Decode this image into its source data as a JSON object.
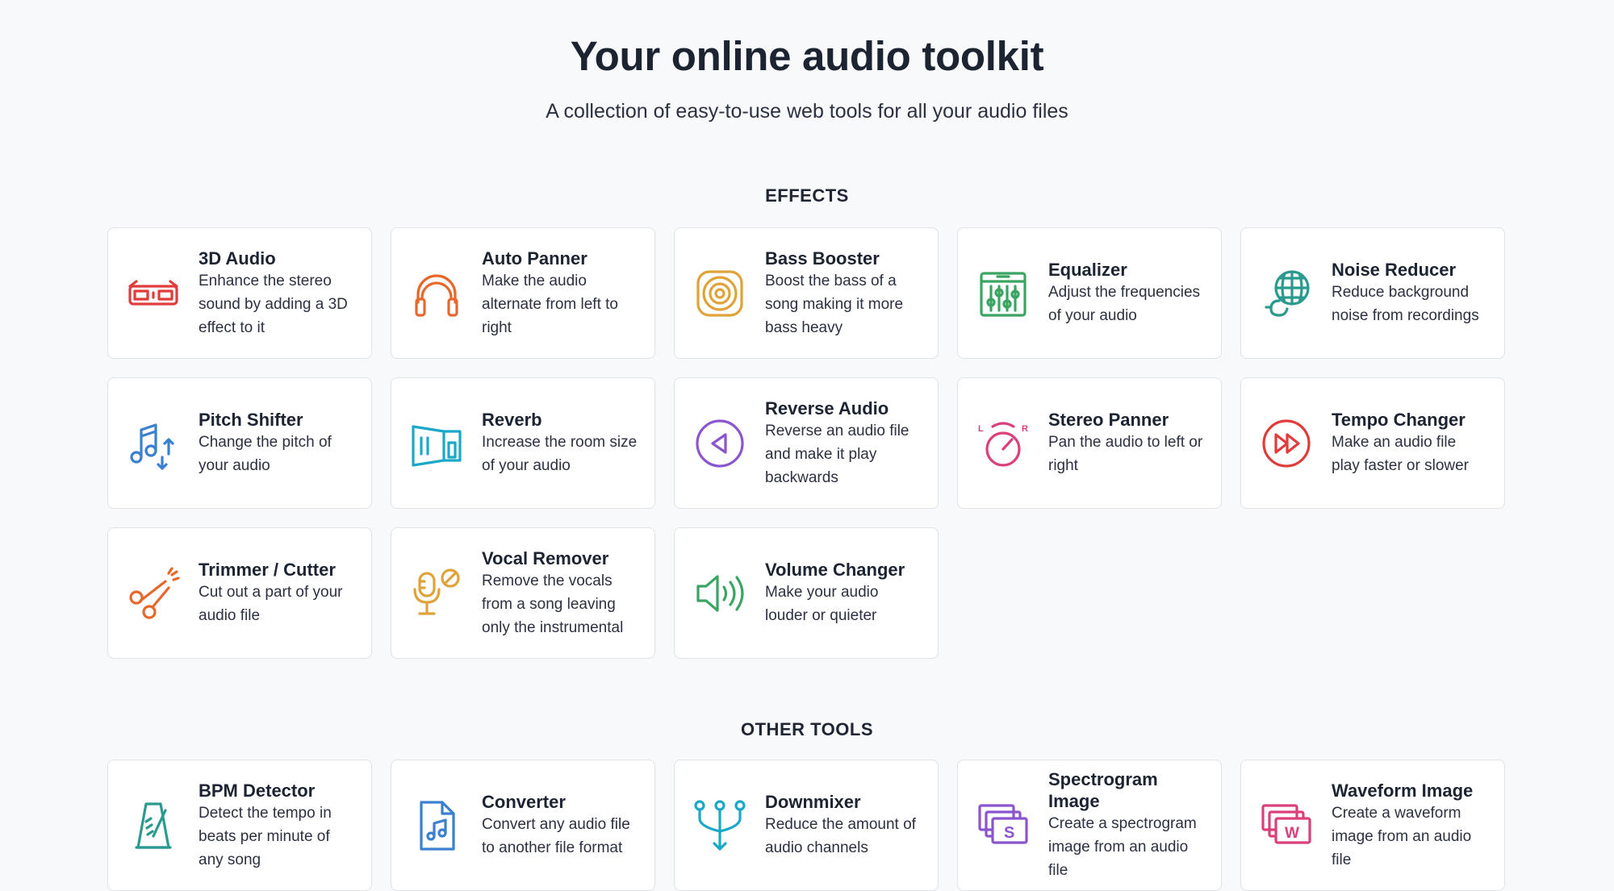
{
  "header": {
    "title": "Your online audio toolkit",
    "subtitle": "A collection of easy-to-use web tools for all your audio files"
  },
  "sections": {
    "effects": {
      "title": "EFFECTS",
      "tools": [
        {
          "name": "3D Audio",
          "desc": "Enhance the stereo sound by adding a 3D effect to it",
          "icon": "3d-glasses-icon",
          "color": "#e03c3c"
        },
        {
          "name": "Auto Panner",
          "desc": "Make the audio alternate from left to right",
          "icon": "headphones-icon",
          "color": "#e8672a"
        },
        {
          "name": "Bass Booster",
          "desc": "Boost the bass of a song making it more bass heavy",
          "icon": "speaker-icon",
          "color": "#e0a339"
        },
        {
          "name": "Equalizer",
          "desc": "Adjust the frequencies of your audio",
          "icon": "equalizer-icon",
          "color": "#3aa562"
        },
        {
          "name": "Noise Reducer",
          "desc": "Reduce background noise from recordings",
          "icon": "globe-microphone-icon",
          "color": "#2a9a8e"
        },
        {
          "name": "Pitch Shifter",
          "desc": "Change the pitch of your audio",
          "icon": "music-note-arrows-icon",
          "color": "#3b7fd1"
        },
        {
          "name": "Reverb",
          "desc": "Increase the room size of your audio",
          "icon": "room-icon",
          "color": "#1aa8c9"
        },
        {
          "name": "Reverse Audio",
          "desc": "Reverse an audio file and make it play backwards",
          "icon": "reverse-play-icon",
          "color": "#8a55cf"
        },
        {
          "name": "Stereo Panner",
          "desc": "Pan the audio to left or right",
          "icon": "pan-knob-icon",
          "color": "#d9407c"
        },
        {
          "name": "Tempo Changer",
          "desc": "Make an audio file play faster or slower",
          "icon": "fast-forward-icon",
          "color": "#e03c3c"
        },
        {
          "name": "Trimmer / Cutter",
          "desc": "Cut out a part of your audio file",
          "icon": "scissors-icon",
          "color": "#e8672a"
        },
        {
          "name": "Vocal Remover",
          "desc": "Remove the vocals from a song leaving only the instrumental",
          "icon": "no-microphone-icon",
          "color": "#e0a339"
        },
        {
          "name": "Volume Changer",
          "desc": "Make your audio louder or quieter",
          "icon": "volume-icon",
          "color": "#3aa562"
        }
      ]
    },
    "other": {
      "title": "OTHER TOOLS",
      "tools": [
        {
          "name": "BPM Detector",
          "desc": "Detect the tempo in beats per minute of any song",
          "icon": "metronome-icon",
          "color": "#2a9a8e"
        },
        {
          "name": "Converter",
          "desc": "Convert any audio file to another file format",
          "icon": "audio-file-icon",
          "color": "#3b7fd1"
        },
        {
          "name": "Downmixer",
          "desc": "Reduce the amount of audio channels",
          "icon": "merge-arrows-icon",
          "color": "#1aa8c9"
        },
        {
          "name": "Spectrogram Image",
          "desc": "Create a spectrogram image from an audio file",
          "icon": "spectrogram-image-icon",
          "color": "#8a55cf"
        },
        {
          "name": "Waveform Image",
          "desc": "Create a waveform image from an audio file",
          "icon": "waveform-image-icon",
          "color": "#d9407c"
        }
      ]
    }
  }
}
